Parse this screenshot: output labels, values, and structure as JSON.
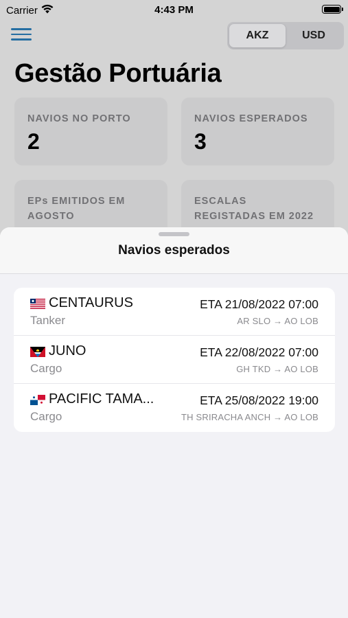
{
  "status_bar": {
    "carrier": "Carrier",
    "time": "4:43 PM"
  },
  "header": {
    "currency_options": [
      "AKZ",
      "USD"
    ],
    "selected_currency": "AKZ",
    "title": "Gestão Portuária"
  },
  "stats": [
    {
      "label": "NAVIOS NO PORTO",
      "value": "2"
    },
    {
      "label": "NAVIOS ESPERADOS",
      "value": "3"
    },
    {
      "label": "EPs EMITIDOS EM AGOSTO",
      "value": ""
    },
    {
      "label": "ESCALAS REGISTADAS EM 2022",
      "value": ""
    }
  ],
  "sheet": {
    "title": "Navios esperados",
    "ships": [
      {
        "flag": "liberia-flag",
        "name": "CENTAURUS",
        "type": "Tanker",
        "eta": "ETA 21/08/2022 07:00",
        "route": "AR SLO → AO LOB"
      },
      {
        "flag": "antigua-barbuda-flag",
        "name": "JUNO",
        "type": "Cargo",
        "eta": "ETA 22/08/2022 07:00",
        "route": "GH TKD → AO LOB"
      },
      {
        "flag": "panama-flag",
        "name": "PACIFIC TAMA...",
        "type": "Cargo",
        "eta": "ETA 25/08/2022 19:00",
        "route": "TH SRIRACHA ANCH → AO LOB"
      }
    ]
  },
  "colors": {
    "accent": "#2a7bb5",
    "sheet_bg": "#f2f2f6",
    "card_bg": "#e2e2e4"
  }
}
